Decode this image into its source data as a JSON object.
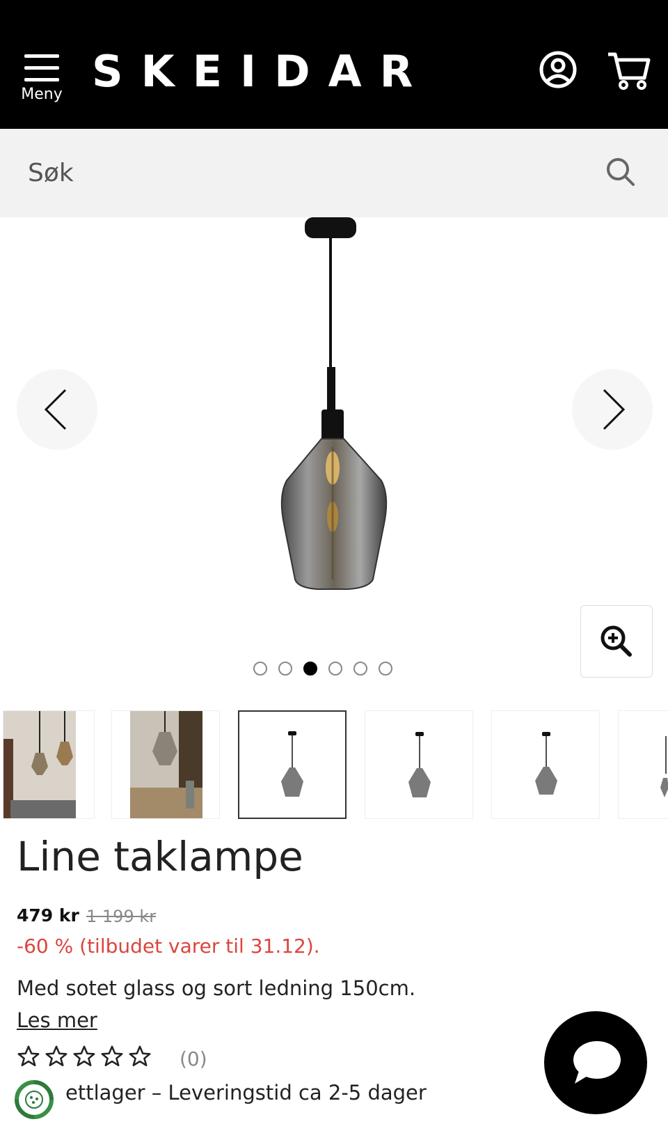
{
  "header": {
    "menu_label": "Meny",
    "logo_text": "SKEIDAR",
    "bg_color": "#000000"
  },
  "search": {
    "placeholder": "Søk"
  },
  "gallery": {
    "dots_total": 6,
    "active_index": 3
  },
  "product": {
    "title": "Line taklampe",
    "price": "479 kr",
    "old_price": "1 199 kr",
    "discount": "-60 % (tilbudet varer til 31.12).",
    "description": "Med sotet glass og sort ledning 150cm.",
    "read_more": "Les mer",
    "rating_count": "(0)",
    "stock": "ettlager – Leveringstid ca 2-5 dager"
  },
  "colors": {
    "discount": "#d9463e",
    "accent": "#000000"
  },
  "icons": [
    "menu-icon",
    "account-icon",
    "cart-icon",
    "search-icon",
    "chevron-left-icon",
    "chevron-right-icon",
    "zoom-in-icon",
    "star-icon",
    "recycle-icon",
    "chat-icon"
  ]
}
